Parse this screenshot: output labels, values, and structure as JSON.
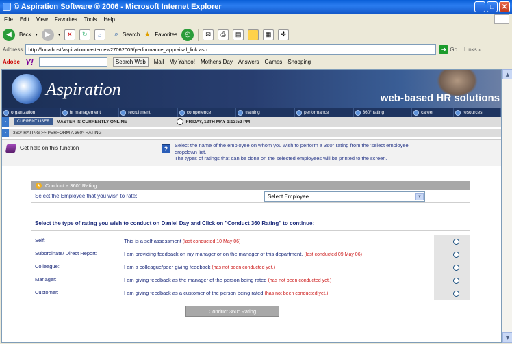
{
  "window": {
    "title": "© Aspiration Software ® 2006 - Microsoft Internet Explorer",
    "controls": {
      "minimize": "_",
      "maximize": "□",
      "close": "✕"
    }
  },
  "menu": [
    "File",
    "Edit",
    "View",
    "Favorites",
    "Tools",
    "Help"
  ],
  "toolbar": {
    "back": "Back",
    "search": "Search",
    "favorites": "Favorites"
  },
  "address": {
    "label": "Address",
    "url": "http://localhost/aspirationmasternew27062005/performance_appraisal_link.asp",
    "go": "Go",
    "links": "Links »"
  },
  "yahoo_bar": {
    "adobe": "Adobe",
    "logo": "Y!",
    "search_web": "Search Web",
    "items": [
      "Mail",
      "My Yahoo!",
      "Mother's Day",
      "Answers",
      "Games",
      "Shopping"
    ]
  },
  "banner": {
    "brand": "Aspiration",
    "tagline_pre": "web-based ",
    "tagline_hr": "HR",
    "tagline_post": " solutions"
  },
  "nav": [
    "organization",
    "hr management",
    "recruitment",
    "competence",
    "training",
    "performance",
    "360° rating",
    "career",
    "resources"
  ],
  "user_strip": {
    "badge": "CURRENT USER",
    "status": "MASTER IS CURRENTLY ONLINE",
    "datetime": "FRIDAY, 12TH MAY 1:13:52 PM"
  },
  "breadcrumb": "360° RATING >> PERFORM A 360° RATING",
  "help": {
    "link": "Get help on this function",
    "text_line1": "Select the name of the employee on whom you wish to perform a 360° rating from the 'select employee'",
    "text_line2": "dropdown list.",
    "text_line3": "The types of ratings that can be done on the selected employees will be printed to the screen."
  },
  "panel": {
    "heading": "Conduct a 360° Rating",
    "select_label": "Select the Employee that you wish to rate:",
    "select_value": "Select Employee"
  },
  "instruction": "Select the type of rating you wish to conduct on Daniel Day and Click on \"Conduct 360 Rating\" to continue:",
  "ratings": [
    {
      "name": "Self:",
      "desc": "This is a self assessment ",
      "note": "(last conducted 10 May 06)"
    },
    {
      "name": "Subordinate/ Direct Report:",
      "desc": "I am providing feedback on my manager or on the manager of this department. ",
      "note": "(last conducted 09 May 06)"
    },
    {
      "name": "Colleague:",
      "desc": "I am a colleague/peer giving feedback ",
      "note": "(has not been conducted yet.)"
    },
    {
      "name": "Manager:",
      "desc": "I am giving feedback as the manager of the person being rated ",
      "note": "(has not been conducted yet.)"
    },
    {
      "name": "Customer:",
      "desc": "I am giving feedback as a customer of the person being rated ",
      "note": "(has not been conducted yet.)"
    }
  ],
  "submit_label": "Conduct 360° Rating"
}
